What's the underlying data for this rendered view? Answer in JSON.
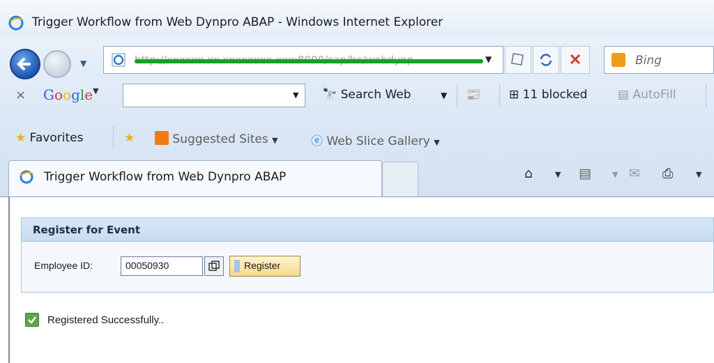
{
  "window": {
    "title": "Trigger Workflow from Web Dynpro ABAP - Windows Internet Explorer"
  },
  "address_bar": {
    "url": "http://xxxxxx.xx.xxxxxxxx.xxx:8000/sap/bc/webdynp"
  },
  "search_box": {
    "placeholder": "Bing"
  },
  "google_toolbar": {
    "logo": "Google",
    "search_web_label": "Search Web",
    "blocked_label": "11 blocked",
    "autofill_label": "AutoFill"
  },
  "favorites_bar": {
    "favorites_label": "Favorites",
    "suggested_sites_label": "Suggested Sites",
    "web_slice_label": "Web Slice Gallery"
  },
  "tab": {
    "title": "Trigger Workflow from Web Dynpro ABAP"
  },
  "page": {
    "panel_title": "Register for Event",
    "employee_label": "Employee ID:",
    "employee_value": "00050930",
    "register_label": "Register",
    "status_message": "Registered Successfully.."
  },
  "colors": {
    "accent_green": "#1a9e2b",
    "panel_header": "#c7dbf1",
    "button_yellow": "#f6d98b"
  }
}
